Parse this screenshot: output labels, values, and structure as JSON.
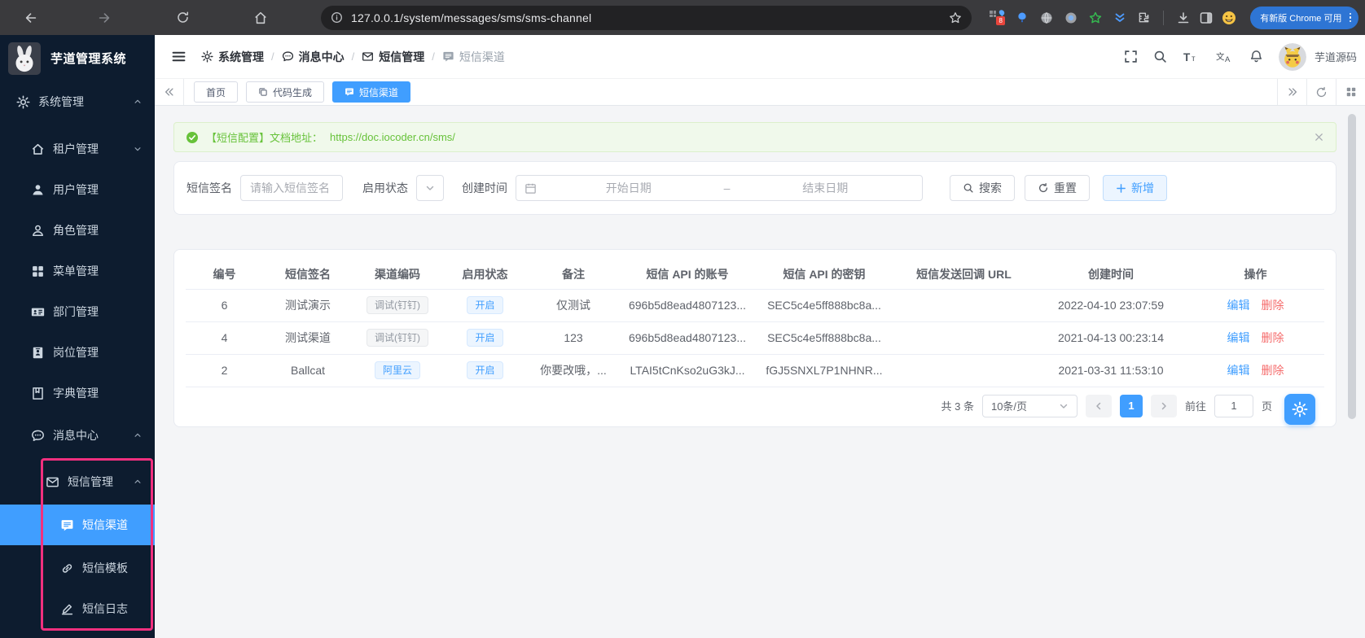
{
  "browser": {
    "url": "127.0.0.1/system/messages/sms/sms-channel",
    "update_button_label": "有新版 Chrome 可用",
    "extension_badge": "8"
  },
  "sidebar": {
    "app_title": "芋道管理系统",
    "items": [
      {
        "key": "system",
        "icon": "gear",
        "label": "系统管理",
        "level": 1,
        "chevron": "up",
        "active": false
      },
      {
        "key": "tenant",
        "icon": "home",
        "label": "租户管理",
        "level": 2,
        "chevron": "down",
        "active": false
      },
      {
        "key": "user",
        "icon": "user",
        "label": "用户管理",
        "level": 2,
        "chevron": null,
        "active": false
      },
      {
        "key": "role",
        "icon": "user-outline",
        "label": "角色管理",
        "level": 2,
        "chevron": null,
        "active": false
      },
      {
        "key": "menu",
        "icon": "grid",
        "label": "菜单管理",
        "level": 2,
        "chevron": null,
        "active": false
      },
      {
        "key": "dept",
        "icon": "id-card",
        "label": "部门管理",
        "level": 2,
        "chevron": null,
        "active": false
      },
      {
        "key": "post",
        "icon": "badge",
        "label": "岗位管理",
        "level": 2,
        "chevron": null,
        "active": false
      },
      {
        "key": "dict",
        "icon": "book",
        "label": "字典管理",
        "level": 2,
        "chevron": null,
        "active": false
      },
      {
        "key": "message-center",
        "icon": "chat",
        "label": "消息中心",
        "level": 2,
        "chevron": "up",
        "active": false
      },
      {
        "key": "sms",
        "icon": "mail",
        "label": "短信管理",
        "level": 3,
        "chevron": "up",
        "active": false
      },
      {
        "key": "sms-channel",
        "icon": "sms",
        "label": "短信渠道",
        "level": 4,
        "chevron": null,
        "active": true
      },
      {
        "key": "sms-template",
        "icon": "link",
        "label": "短信模板",
        "level": 4,
        "chevron": null,
        "active": false
      },
      {
        "key": "sms-log",
        "icon": "edit",
        "label": "短信日志",
        "level": 4,
        "chevron": null,
        "active": false
      }
    ]
  },
  "topbar": {
    "breadcrumb": [
      {
        "key": "system",
        "icon": "gear",
        "label": "系统管理"
      },
      {
        "key": "message-center",
        "icon": "chat",
        "label": "消息中心"
      },
      {
        "key": "sms",
        "icon": "mail",
        "label": "短信管理"
      },
      {
        "key": "sms-channel",
        "icon": "sms",
        "label": "短信渠道"
      }
    ],
    "username": "芋道源码"
  },
  "tabs": [
    {
      "key": "home",
      "label": "首页",
      "icon": null,
      "active": false
    },
    {
      "key": "codegen",
      "label": "代码生成",
      "icon": "copy",
      "active": false
    },
    {
      "key": "sms-channel",
      "label": "短信渠道",
      "icon": "sms",
      "active": true
    }
  ],
  "alert": {
    "text": "【短信配置】文档地址：",
    "link": "https://doc.iocoder.cn/sms/"
  },
  "filters": {
    "sign_label": "短信签名",
    "sign_placeholder": "请输入短信签名",
    "status_label": "启用状态",
    "time_label": "创建时间",
    "start_placeholder": "开始日期",
    "range_separator": "–",
    "end_placeholder": "结束日期",
    "search_label": "搜索",
    "reset_label": "重置",
    "add_label": "新增"
  },
  "table": {
    "columns": [
      "编号",
      "短信签名",
      "渠道编码",
      "启用状态",
      "备注",
      "短信 API 的账号",
      "短信 API 的密钥",
      "短信发送回调 URL",
      "创建时间",
      "操作"
    ],
    "edit_label": "编辑",
    "delete_label": "删除",
    "rows": [
      {
        "id": "6",
        "sign": "测试演示",
        "channel": "调试(钉钉)",
        "channel_tag": "gray",
        "status": "开启",
        "remark": "仅测试",
        "api_account": "696b5d8ead4807123...",
        "api_secret": "SEC5c4e5ff888bc8a...",
        "callback": "",
        "created": "2022-04-10 23:07:59"
      },
      {
        "id": "4",
        "sign": "测试渠道",
        "channel": "调试(钉钉)",
        "channel_tag": "gray",
        "status": "开启",
        "remark": "123",
        "api_account": "696b5d8ead4807123...",
        "api_secret": "SEC5c4e5ff888bc8a...",
        "callback": "",
        "created": "2021-04-13 00:23:14"
      },
      {
        "id": "2",
        "sign": "Ballcat",
        "channel": "阿里云",
        "channel_tag": "blue",
        "status": "开启",
        "remark": "你要改哦，...",
        "api_account": "LTAI5tCnKso2uG3kJ...",
        "api_secret": "fGJ5SNXL7P1NHNR...",
        "callback": "",
        "created": "2021-03-31 11:53:10"
      }
    ]
  },
  "pagination": {
    "total": "共 3 条",
    "page_size": "10条/页",
    "current": "1",
    "goto_label": "前往",
    "goto_value": "1",
    "unit_label": "页"
  },
  "colors": {
    "accent": "#409eff",
    "success": "#67c23a",
    "danger": "#f56c6c",
    "annotation_pink": "#f1307e",
    "sidebar_bg": "#0d1c2f"
  }
}
